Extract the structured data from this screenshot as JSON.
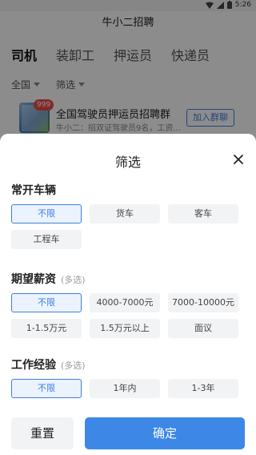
{
  "status_bar": {
    "time": "5:26"
  },
  "app": {
    "title": "牛小二招聘"
  },
  "tabs": [
    {
      "label": "司机",
      "active": true
    },
    {
      "label": "装卸工",
      "active": false
    },
    {
      "label": "押运员",
      "active": false
    },
    {
      "label": "快递员",
      "active": false
    }
  ],
  "filters": {
    "region": "全国",
    "filter": "筛选"
  },
  "group_card": {
    "badge": "999",
    "title": "全国驾驶员押运员招聘群",
    "subtitle": "牛小二：招双证驾驶员9名，工资...",
    "join_label": "加入群聊"
  },
  "sheet": {
    "title": "筛选",
    "sections": [
      {
        "title": "常开车辆",
        "hint": "",
        "options": [
          "不限",
          "货车",
          "客车",
          "工程车"
        ],
        "selected": "不限"
      },
      {
        "title": "期望薪资",
        "hint": "(多选)",
        "options": [
          "不限",
          "4000-7000元",
          "7000-10000元",
          "1-1.5万元",
          "1.5万元以上",
          "面议"
        ],
        "selected": "不限"
      },
      {
        "title": "工作经验",
        "hint": "(多选)",
        "options": [
          "不限",
          "1年内",
          "1-3年"
        ],
        "selected": "不限"
      }
    ],
    "reset_label": "重置",
    "confirm_label": "确定"
  },
  "colors": {
    "accent": "#3d7fe0",
    "confirm": "#3d88e6",
    "badge": "#ee4b44"
  }
}
